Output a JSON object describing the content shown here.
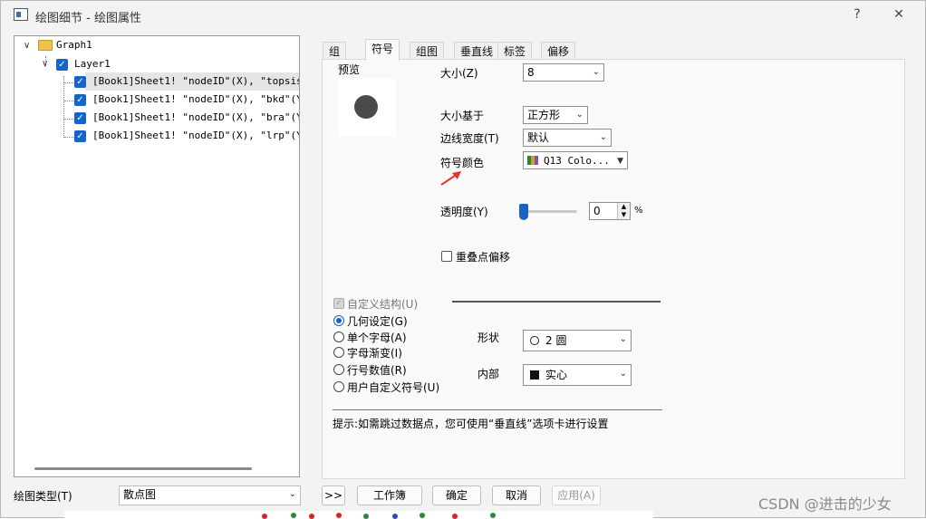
{
  "window": {
    "title": "绘图细节 - 绘图属性",
    "help": "?",
    "close": "✕"
  },
  "tree": {
    "items": [
      {
        "label": "Graph1"
      },
      {
        "label": "Layer1"
      },
      {
        "label": "[Book1]Sheet1! \"nodeID\"(X), \"topsis\"(Y"
      },
      {
        "label": "[Book1]Sheet1! \"nodeID\"(X), \"bkd\"(Y) ["
      },
      {
        "label": "[Book1]Sheet1! \"nodeID\"(X), \"bra\"(Y) ["
      },
      {
        "label": "[Book1]Sheet1! \"nodeID\"(X), \"lrp\"(Y) ["
      }
    ]
  },
  "tabs": [
    "组",
    "符号",
    "组图",
    "垂直线",
    "标签",
    "偏移"
  ],
  "active_tab": "符号",
  "symbol": {
    "preview_label": "预览",
    "size_label": "大小(Z)",
    "size_value": "8",
    "size_basis_label": "大小基于",
    "size_basis_value": "正方形",
    "edge_width_label": "边线宽度(T)",
    "edge_width_value": "默认",
    "color_label": "符号颜色",
    "color_value": "Q13 Colo...",
    "transparency_label": "透明度(Y)",
    "transparency_value": "0",
    "transparency_unit": "%",
    "overlap_offset_label": "重叠点偏移",
    "custom_struct_label": "自定义结构(U)",
    "radio_options": [
      "几何设定(G)",
      "单个字母(A)",
      "字母渐变(I)",
      "行号数值(R)",
      "用户自定义符号(U)"
    ],
    "shape_label": "形状",
    "shape_value": "2 圆",
    "interior_label": "内部",
    "interior_value": "实心",
    "hint": "提示:如需跳过数据点，您可使用“垂直线”选项卡进行设置"
  },
  "footer": {
    "plot_type_label": "绘图类型(T)",
    "plot_type_value": "散点图",
    "more_button": ">>",
    "workbook_button": "工作簿",
    "ok_button": "确定",
    "cancel_button": "取消",
    "apply_button": "应用(A)"
  },
  "watermark": "CSDN @进击的少女",
  "colors": {
    "accent": "#1764c8",
    "arrow": "#e8332a",
    "preview_dot": "#4a4a4a"
  }
}
